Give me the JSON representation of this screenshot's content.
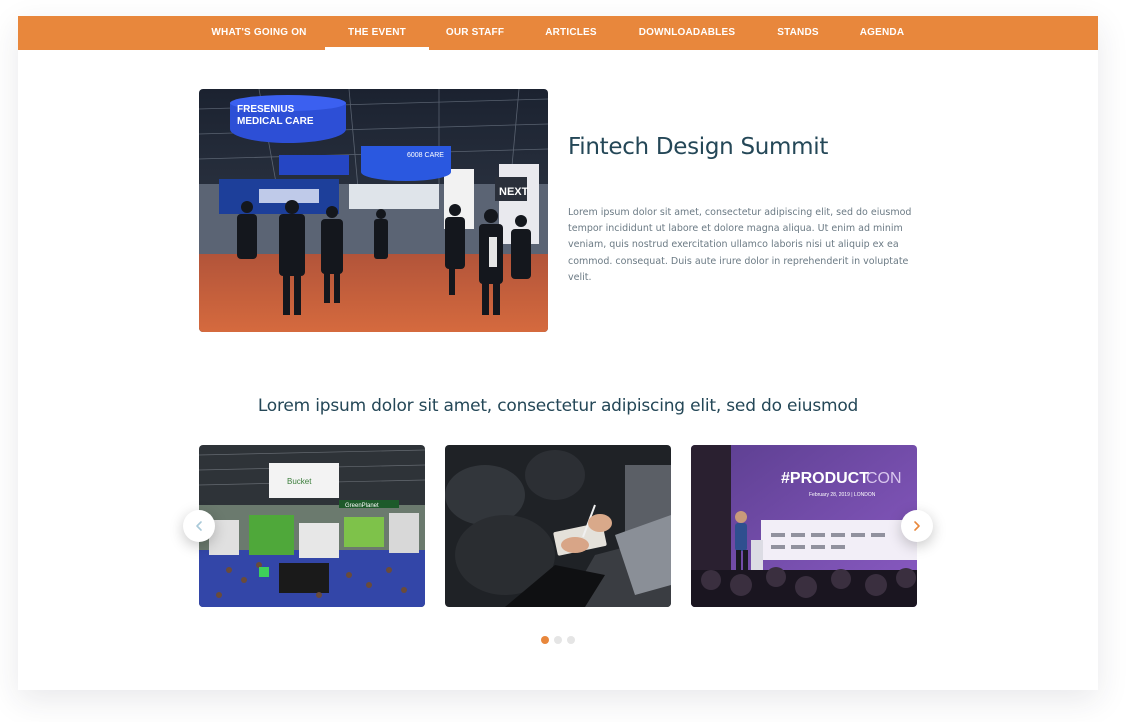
{
  "nav": {
    "items": [
      {
        "label": "WHAT'S GOING ON"
      },
      {
        "label": "THE EVENT"
      },
      {
        "label": "OUR STAFF"
      },
      {
        "label": "ARTICLES"
      },
      {
        "label": "DOWNLOADABLES"
      },
      {
        "label": "STANDS"
      },
      {
        "label": "AGENDA"
      }
    ],
    "active": "THE EVENT"
  },
  "event": {
    "title": "Fintech Design Summit",
    "description": "Lorem ipsum dolor sit amet, consectetur adipiscing elit, sed do eiusmod tempor incididunt ut labore et dolore magna aliqua. Ut enim ad minim veniam, quis nostrud exercitation ullamco laboris nisi ut aliquip ex ea commod. consequat. Duis aute irure dolor in reprehenderit in voluptate velit.",
    "hero_image_text": {
      "banner1": "FRESENIUS",
      "banner2": "MEDICAL CARE",
      "banner3": "6008 CARE",
      "logo": "NEXT"
    }
  },
  "gallery": {
    "title": "Lorem ipsum dolor sit amet, consectetur adipiscing elit, sed do eiusmod",
    "slides": [
      {
        "banner": "Bucket",
        "sign": "GreenPlanet"
      },
      {},
      {
        "headline_a": "#PRODUCT",
        "headline_b": "CON",
        "date": "February 28, 2019 | LONDON"
      }
    ],
    "active_dot": 0,
    "dot_count": 3
  },
  "colors": {
    "accent": "#e8873c",
    "title": "#244757",
    "body_text": "#6b7a84"
  }
}
